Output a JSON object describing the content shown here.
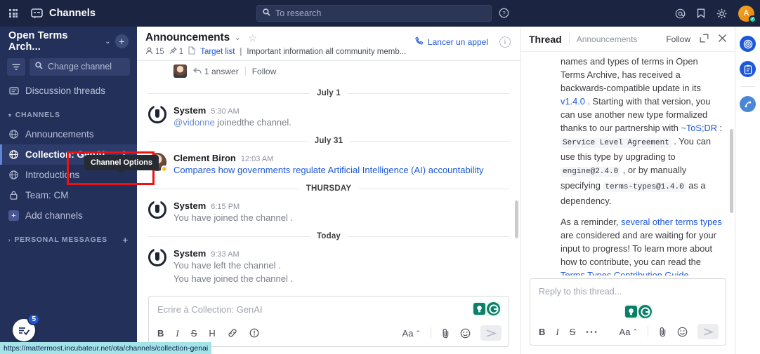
{
  "topbar": {
    "app_title": "Channels",
    "grid_icon": "apps-grid-icon",
    "channels_icon": "chat-bubble-icon",
    "search_placeholder": "To research",
    "search_icon": "search-icon",
    "help_icon": "help-circle-icon",
    "mention_icon": "at-mention-icon",
    "saved_icon": "bookmark-icon",
    "settings_icon": "gear-icon",
    "avatar_initial": "A",
    "avatar_status": "online"
  },
  "sidebar": {
    "team_name": "Open Terms Arch...",
    "team_caret": "⌄",
    "add_label": "+",
    "filter_icon": "filter-icon",
    "search_placeholder": "Change channel",
    "threads_label": "Discussion threads",
    "category_channels": "CHANNELS",
    "category_personal": "PERSONAL MESSAGES",
    "items": [
      {
        "label": "Announcements",
        "icon": "globe-icon",
        "active": false
      },
      {
        "label": "Collection: GenAI",
        "icon": "globe-icon",
        "active": true
      },
      {
        "label": "Introductions",
        "icon": "globe-icon",
        "active": false
      },
      {
        "label": "Team: CM",
        "icon": "lock-icon",
        "active": false
      },
      {
        "label": "Add channels",
        "icon": "plus-box-icon",
        "active": false
      }
    ],
    "unread_count": "5",
    "fab_icon": "checklist-icon"
  },
  "tooltip": {
    "label": "Channel Options"
  },
  "status_url": "https://mattermost.incubateur.net/ota/channels/collection-genai",
  "channel": {
    "title": "Announcements",
    "caret": "⌄",
    "star_icon": "star-outline-icon",
    "members_icon": "member-icon",
    "members_count": "15",
    "pin_icon": "pin-icon",
    "pin_count": "1",
    "file_icon": "file-icon",
    "purpose_link": "Target list",
    "purpose_sep": "|",
    "purpose_text": "Important information all community memb...",
    "call_label": "Lancer un appel",
    "call_icon": "phone-icon",
    "info_icon": "info-circle-icon"
  },
  "thread_preview": {
    "reply_icon": "reply-arrow-icon",
    "reply_count": "1 answer",
    "follow_label": "Follow"
  },
  "messages": [
    {
      "kind": "date",
      "label": "July 1"
    },
    {
      "kind": "message",
      "avatar": "system-bot",
      "author": "System",
      "time": "5:30 AM",
      "text_mention": "@vidonne",
      "text": " joinedthe channel.",
      "link": false
    },
    {
      "kind": "date",
      "label": "July 31"
    },
    {
      "kind": "message",
      "avatar": "user-photo",
      "author": "Clement Biron",
      "time": "12:03 AM",
      "text_mention": "",
      "text": "Compares how governments regulate Artificial Intelligence (AI) accountability",
      "link": true
    },
    {
      "kind": "date",
      "label": "THURSDAY"
    },
    {
      "kind": "message",
      "avatar": "system-bot",
      "author": "System",
      "time": "6:15 PM",
      "text_mention": "",
      "text": "You have joined the channel .",
      "link": false
    },
    {
      "kind": "date",
      "label": "Today"
    },
    {
      "kind": "message",
      "avatar": "system-bot",
      "author": "System",
      "time": "9:33 AM",
      "text_mention": "",
      "text": "You have left the channel .",
      "text2": "You have joined the channel .",
      "link": false
    }
  ],
  "composer": {
    "placeholder": "Ecrire à Collection: GenAI",
    "ai_bulb_icon": "lightbulb-icon",
    "ai_agent_icon": "ai-agent-icon",
    "bold": "B",
    "italic": "I",
    "strike": "S",
    "heading": "H",
    "link_icon": "link-icon",
    "info_icon": "exclamation-circle-icon",
    "more_icon": "ellipsis-icon",
    "format_label": "Aa",
    "format_caret": "⌃",
    "attach_icon": "paperclip-icon",
    "emoji_icon": "emoji-icon",
    "send_icon": "send-icon"
  },
  "rhs": {
    "title": "Thread",
    "channel_name": "Announcements",
    "follow_label": "Follow",
    "expand_icon": "expand-icon",
    "close_icon": "close-icon",
    "paragraphs": [
      {
        "segments": [
          {
            "t": "names and types of terms in Open Terms Archive, has received a backwards-compatible update in its ",
            "s": "plain"
          },
          {
            "t": "v1.4.0",
            "s": "link"
          },
          {
            "t": " . Starting with that version, you can use another new type formalized thanks to our partnership with ",
            "s": "plain"
          },
          {
            "t": "~ToS;DR",
            "s": "link"
          },
          {
            "t": " : ",
            "s": "plain"
          },
          {
            "t": "Service Level Agreement",
            "s": "code"
          },
          {
            "t": " . You can use this type by upgrading to ",
            "s": "plain"
          },
          {
            "t": "engine@2.4.0",
            "s": "code"
          },
          {
            "t": " , or by manually specifying ",
            "s": "plain"
          },
          {
            "t": "terms-types@1.4.0",
            "s": "code"
          },
          {
            "t": " as a dependency.",
            "s": "plain"
          }
        ]
      },
      {
        "segments": [
          {
            "t": "As a reminder, ",
            "s": "plain"
          },
          {
            "t": "several other terms types",
            "s": "link"
          },
          {
            "t": " are considered and are waiting for your input to progress! To learn more about how to contribute, you can read the ",
            "s": "plain"
          },
          {
            "t": "Terms Types Contribution Guide",
            "s": "link"
          },
          {
            "t": " .",
            "s": "plain"
          }
        ]
      }
    ],
    "composer": {
      "placeholder": "Reply to this thread...",
      "bold": "B",
      "italic": "I",
      "strike": "S",
      "more_icon": "ellipsis-icon",
      "format_label": "Aa",
      "format_caret": "⌃",
      "attach_icon": "paperclip-icon",
      "emoji_icon": "emoji-icon",
      "send_icon": "send-icon"
    }
  },
  "rail": {
    "items": [
      {
        "icon": "target-app-icon"
      },
      {
        "icon": "clipboard-app-icon"
      },
      {
        "icon": "playbooks-app-icon"
      }
    ]
  },
  "colors": {
    "sidebar_bg": "#23305a",
    "topbar_bg": "#1b2440",
    "accent_blue": "#1c58d9",
    "highlight_red": "#ee1111",
    "ai_green": "#0a8068",
    "urlbar_bg": "#a4e3e8"
  }
}
